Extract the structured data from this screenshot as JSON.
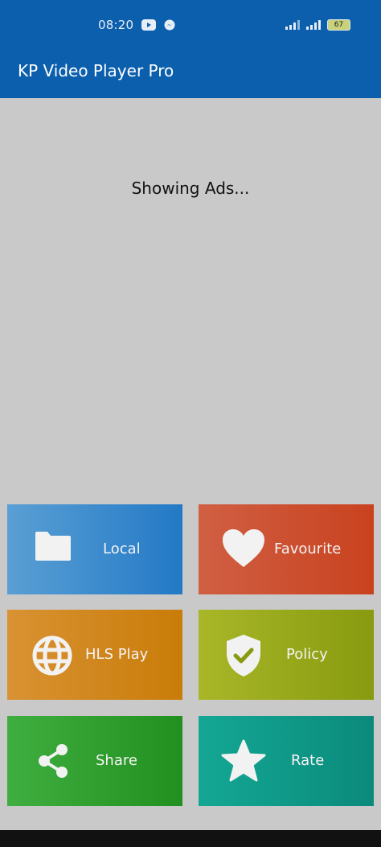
{
  "status_bar": {
    "time": "08:20",
    "icons_left": [
      "youtube-icon",
      "messenger-icon"
    ],
    "icons_right": [
      "signal-icon",
      "signal-icon"
    ],
    "battery": "67"
  },
  "app_bar": {
    "title": "KP Video Player Pro"
  },
  "ad": {
    "text": "Showing Ads..."
  },
  "tiles": [
    {
      "label": "Local",
      "icon": "folder-icon",
      "color": "#2379c6"
    },
    {
      "label": "Favourite",
      "icon": "heart-icon",
      "color": "#c9421f"
    },
    {
      "label": "HLS Play",
      "icon": "globe-icon",
      "color": "#c97c09"
    },
    {
      "label": "Policy",
      "icon": "shield-check-icon",
      "color": "#889a0f"
    },
    {
      "label": "Share",
      "icon": "share-icon",
      "color": "#22901f"
    },
    {
      "label": "Rate",
      "icon": "star-icon",
      "color": "#0b8a7b"
    }
  ]
}
